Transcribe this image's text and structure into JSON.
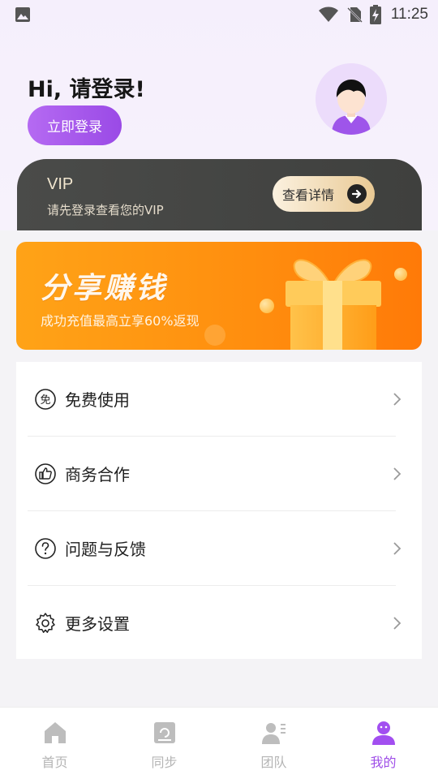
{
  "status_bar": {
    "time": "11:25",
    "icons": [
      "gallery-icon",
      "wifi-icon",
      "no-sim-icon",
      "battery-charging-icon"
    ]
  },
  "profile": {
    "greeting": "Hi, 请登录!",
    "login_button": "立即登录",
    "avatar_icon": "user-avatar-icon"
  },
  "vip": {
    "title": "VIP",
    "subtitle": "请先登录查看您的VIP",
    "details_button": "查看详情",
    "details_icon": "arrow-right-circle-icon"
  },
  "share_banner": {
    "title": "分享赚钱",
    "subtitle": "成功充值最高立享60%返现",
    "image_icon": "gift-box-icon"
  },
  "menu": {
    "items": [
      {
        "label": "免费使用",
        "icon": "free-icon"
      },
      {
        "label": "商务合作",
        "icon": "thumbs-up-icon"
      },
      {
        "label": "问题与反馈",
        "icon": "question-icon"
      },
      {
        "label": "更多设置",
        "icon": "settings-gear-icon"
      }
    ]
  },
  "tab_bar": {
    "tabs": [
      {
        "label": "首页",
        "icon": "home-icon",
        "active": false
      },
      {
        "label": "同步",
        "icon": "sync-icon",
        "active": false
      },
      {
        "label": "团队",
        "icon": "team-icon",
        "active": false
      },
      {
        "label": "我的",
        "icon": "profile-icon",
        "active": true
      }
    ]
  },
  "colors": {
    "accent_purple": "#9f4ee8",
    "vip_card": "#444543",
    "banner_orange": "#ff8d0e",
    "background": "#f4f3f6"
  }
}
